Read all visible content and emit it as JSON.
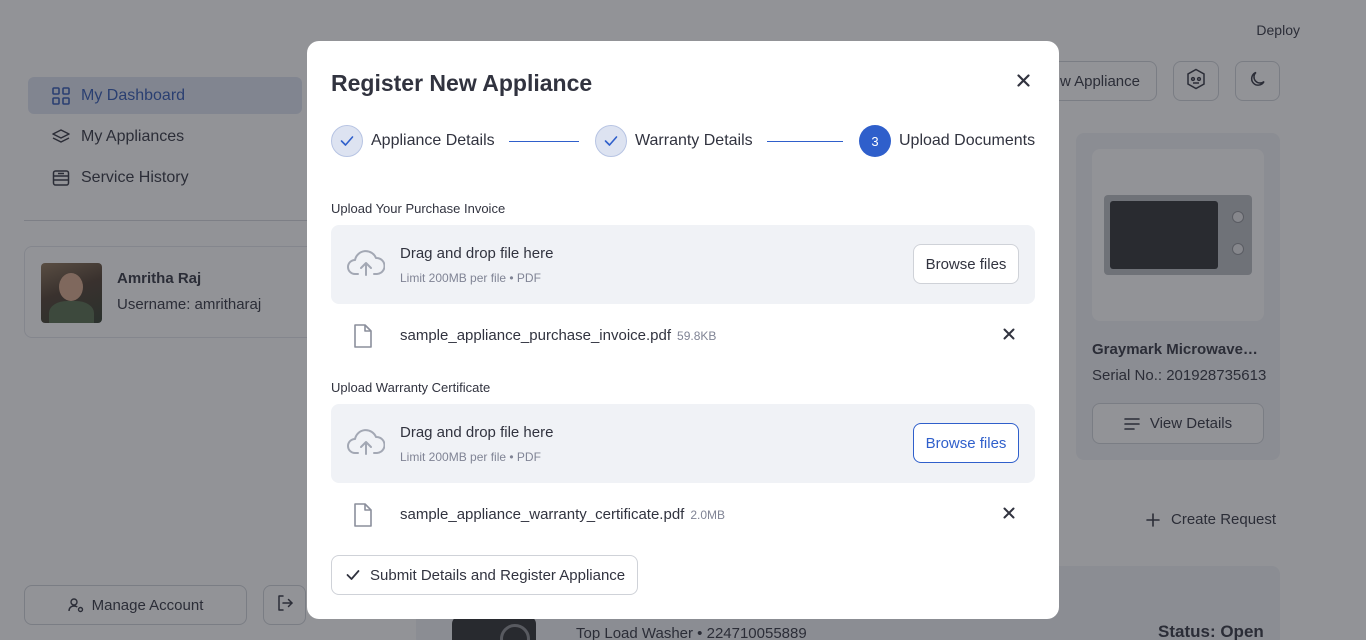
{
  "app": {
    "deploy_label": "Deploy",
    "sidebar": {
      "items": [
        {
          "label": "My Dashboard",
          "icon": "grid-icon",
          "active": true
        },
        {
          "label": "My Appliances",
          "icon": "layers-icon",
          "active": false
        },
        {
          "label": "Service History",
          "icon": "history-icon",
          "active": false
        }
      ],
      "profile": {
        "name": "Amritha Raj",
        "username": "Username: amritharaj"
      },
      "manage_account_label": "Manage Account"
    },
    "header": {
      "new_appliance_label": "w Appliance"
    },
    "appliance_card": {
      "name": "Graymark Microwave Oven",
      "serial": "Serial No.: 201928735613",
      "view_details_label": "View Details"
    },
    "create_request_label": "Create Request",
    "request": {
      "title": "Top Load Washer • 224710055889",
      "status": "Status: Open"
    }
  },
  "modal": {
    "title": "Register New Appliance",
    "steps": [
      {
        "label": "Appliance Details",
        "state": "done",
        "marker": "✓"
      },
      {
        "label": "Warranty Details",
        "state": "done",
        "marker": "✓"
      },
      {
        "label": "Upload Documents",
        "state": "current",
        "marker": "3"
      }
    ],
    "invoice": {
      "label": "Upload Your Purchase Invoice",
      "dropzone_title": "Drag and drop file here",
      "dropzone_limit": "Limit 200MB per file • PDF",
      "browse_label": "Browse files",
      "file_name": "sample_appliance_purchase_invoice.pdf",
      "file_size": "59.8KB"
    },
    "warranty": {
      "label": "Upload Warranty Certificate",
      "dropzone_title": "Drag and drop file here",
      "dropzone_limit": "Limit 200MB per file • PDF",
      "browse_label": "Browse files",
      "file_name": "sample_appliance_warranty_certificate.pdf",
      "file_size": "2.0MB"
    },
    "submit_label": "Submit Details and Register Appliance"
  },
  "colors": {
    "accent": "#2f5fcb",
    "overlay": "rgba(38,39,48,0.5)",
    "surface": "#f0f2f6",
    "text": "#31333f",
    "muted": "#808495"
  }
}
